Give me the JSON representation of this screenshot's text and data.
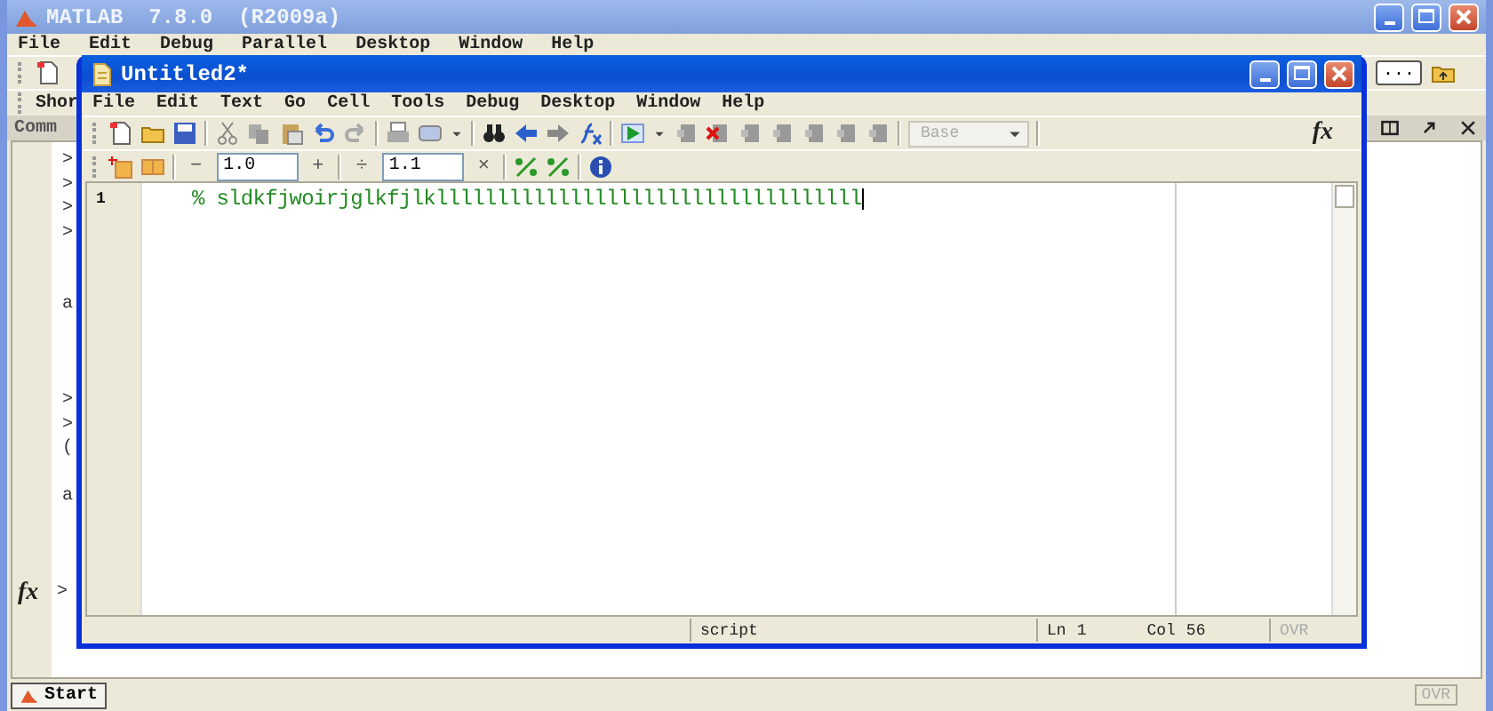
{
  "main_window": {
    "title": "MATLAB  7.8.0  (R2009a)",
    "menu": [
      "File",
      "Edit",
      "Debug",
      "Parallel",
      "Desktop",
      "Window",
      "Help"
    ],
    "browse_button": "...",
    "shortcuts_label": "Shor",
    "panel_title": "Comm",
    "command_lines": [
      {
        "kind": "prompt",
        "text": ">"
      },
      {
        "kind": "prompt",
        "text": ">"
      },
      {
        "kind": "prompt",
        "text": ">"
      },
      {
        "kind": "prompt",
        "text": ">"
      },
      {
        "kind": "blank"
      },
      {
        "kind": "blank"
      },
      {
        "kind": "output",
        "text": "a"
      },
      {
        "kind": "blank"
      },
      {
        "kind": "blank"
      },
      {
        "kind": "blank"
      },
      {
        "kind": "prompt",
        "text": ">"
      },
      {
        "kind": "prompt",
        "text": ">"
      },
      {
        "kind": "output",
        "text": "("
      },
      {
        "kind": "blank"
      },
      {
        "kind": "output",
        "text": "a"
      },
      {
        "kind": "blank"
      },
      {
        "kind": "blank"
      },
      {
        "kind": "blank"
      },
      {
        "kind": "current",
        "text": ">"
      }
    ],
    "status": "OVR",
    "function_button": "fx",
    "start_button": "Start"
  },
  "editor": {
    "title": "Untitled2*",
    "menu": [
      "File",
      "Edit",
      "Text",
      "Go",
      "Cell",
      "Tools",
      "Debug",
      "Desktop",
      "Window",
      "Help"
    ],
    "workspace_select": {
      "value": "Base",
      "disabled": true
    },
    "function_button": "fx",
    "cell_toolbar": {
      "minus": "−",
      "decrement": "1.0",
      "plus": "+",
      "divide": "÷",
      "scale": "1.1",
      "times": "×"
    },
    "lines": [
      {
        "number": "1",
        "text": "% sldkfjwoirjglkfjlklllllllllllllllllllllllllllllllllll"
      }
    ],
    "status": {
      "mode": "script",
      "ln_label": "Ln",
      "ln": "1",
      "col_label": "Col",
      "col": "56",
      "ovr": "OVR"
    }
  }
}
